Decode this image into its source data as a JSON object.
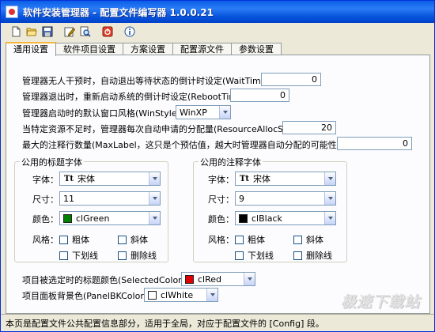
{
  "window": {
    "title": "软件安装管理器 - 配置文件编写器 1.0.0.21"
  },
  "toolbar": {
    "icons": [
      "new-file-icon",
      "open-folder-icon",
      "save-icon",
      "edit-icon",
      "preview-icon",
      "exit-icon",
      "about-icon"
    ]
  },
  "tabs": [
    "通用设置",
    "软件项目设置",
    "方案设置",
    "配置源文件",
    "参数设置"
  ],
  "active_tab": 0,
  "settings": {
    "wait_time": {
      "label": "管理器无人干预时，自动退出等待状态的倒计时设定(WaitTime)：",
      "value": "0"
    },
    "reboot_time": {
      "label": "管理器退出时，重新启动系统的倒计时设定(RebootTime)：",
      "value": "0"
    },
    "win_style": {
      "label": "管理器启动时的默认窗口风格(WinStyle)：",
      "value": "WinXP"
    },
    "resource_alloc": {
      "label": "当特定资源不足时，管理器每次自动申请的分配量(ResourceAllocStep)：",
      "value": "20"
    },
    "max_label": {
      "label": "最大的注释行数量(MaxLabel，这只是个预估值，越大时管理器自动分配的可能性越小)：",
      "value": "0"
    }
  },
  "title_font": {
    "legend": "公用的标题字体",
    "font_label": "字体：",
    "font_value": "宋体",
    "size_label": "尺寸：",
    "size_value": "11",
    "color_label": "颜色：",
    "color_value": "clGreen",
    "color_hex": "#008000",
    "style_label": "风格：",
    "styles": {
      "bold": "粗体",
      "italic": "斜体",
      "underline": "下划线",
      "strikeout": "删除线"
    }
  },
  "note_font": {
    "legend": "公用的注释字体",
    "font_label": "字体：",
    "font_value": "宋体",
    "size_label": "尺寸：",
    "size_value": "9",
    "color_label": "颜色：",
    "color_value": "clBlack",
    "color_hex": "#000000",
    "style_label": "风格：",
    "styles": {
      "bold": "粗体",
      "italic": "斜体",
      "underline": "下划线",
      "strikeout": "删除线"
    }
  },
  "selected_color": {
    "label": "项目被选定时的标题颜色(SelectedColor)：",
    "value": "clRed",
    "color_hex": "#e00000"
  },
  "panel_bk_color": {
    "label": "项目面板背景色(PanelBKColor)：",
    "value": "clWhite",
    "color_hex": "#ffffff"
  },
  "status": {
    "text": "本页是配置文件公共配置信息部分，适用于全局，对应于配置文件的 [Config] 段。"
  },
  "watermark": {
    "text": "极速下载站"
  }
}
